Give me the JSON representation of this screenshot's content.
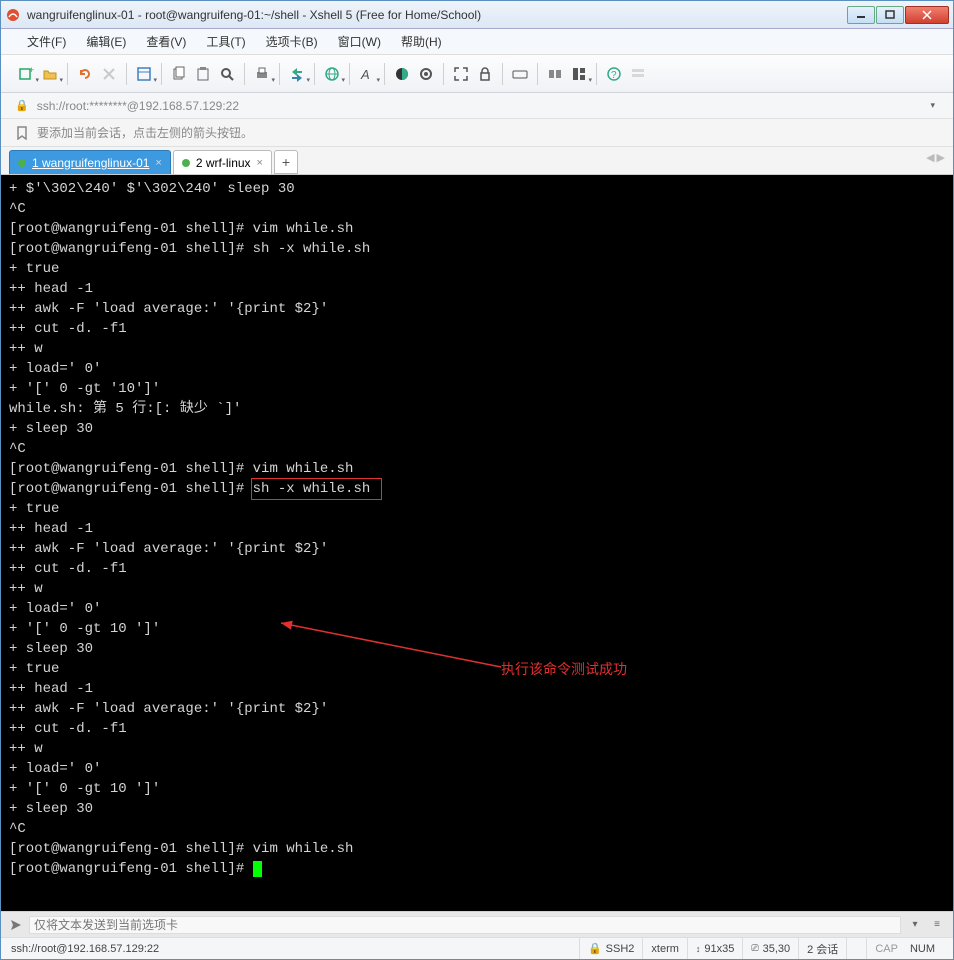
{
  "title": "wangruifenglinux-01 - root@wangruifeng-01:~/shell - Xshell 5 (Free for Home/School)",
  "menu": {
    "file": "文件(F)",
    "edit": "编辑(E)",
    "view": "查看(V)",
    "tools": "工具(T)",
    "tabs": "选项卡(B)",
    "window": "窗口(W)",
    "help": "帮助(H)"
  },
  "address": "ssh://root:********@192.168.57.129:22",
  "hint": "要添加当前会话，点击左侧的箭头按钮。",
  "tabs": [
    {
      "label": "1 wangruifenglinux-01",
      "active": true
    },
    {
      "label": "2 wrf-linux",
      "active": false
    }
  ],
  "terminal_lines": [
    "+ $'\\302\\240' $'\\302\\240' sleep 30",
    "^C",
    "[root@wangruifeng-01 shell]# vim while.sh",
    "[root@wangruifeng-01 shell]# sh -x while.sh",
    "+ true",
    "++ head -1",
    "++ awk -F 'load average:' '{print $2}'",
    "++ cut -d. -f1",
    "++ w",
    "+ load=' 0'",
    "+ '[' 0 -gt '10']'",
    "while.sh: 第 5 行:[: 缺少 `]'",
    "+ sleep 30",
    "^C",
    "[root@wangruifeng-01 shell]# vim while.sh",
    "[root@wangruifeng-01 shell]# sh -x while.sh",
    "+ true",
    "++ head -1",
    "++ awk -F 'load average:' '{print $2}'",
    "++ cut -d. -f1",
    "++ w",
    "+ load=' 0'",
    "+ '[' 0 -gt 10 ']'",
    "+ sleep 30",
    "+ true",
    "++ head -1",
    "++ awk -F 'load average:' '{print $2}'",
    "++ cut -d. -f1",
    "++ w",
    "+ load=' 0'",
    "+ '[' 0 -gt 10 ']'",
    "+ sleep 30",
    "^C",
    "[root@wangruifeng-01 shell]# vim while.sh",
    "[root@wangruifeng-01 shell]# "
  ],
  "annotation": "执行该命令测试成功",
  "input_placeholder": "仅将文本发送到当前选项卡",
  "status": {
    "left": "ssh://root@192.168.57.129:22",
    "ssh": "SSH2",
    "term": "xterm",
    "size": "91x35",
    "pos": "35,30",
    "sessions": "2 会话",
    "cap": "CAP",
    "num": "NUM"
  }
}
